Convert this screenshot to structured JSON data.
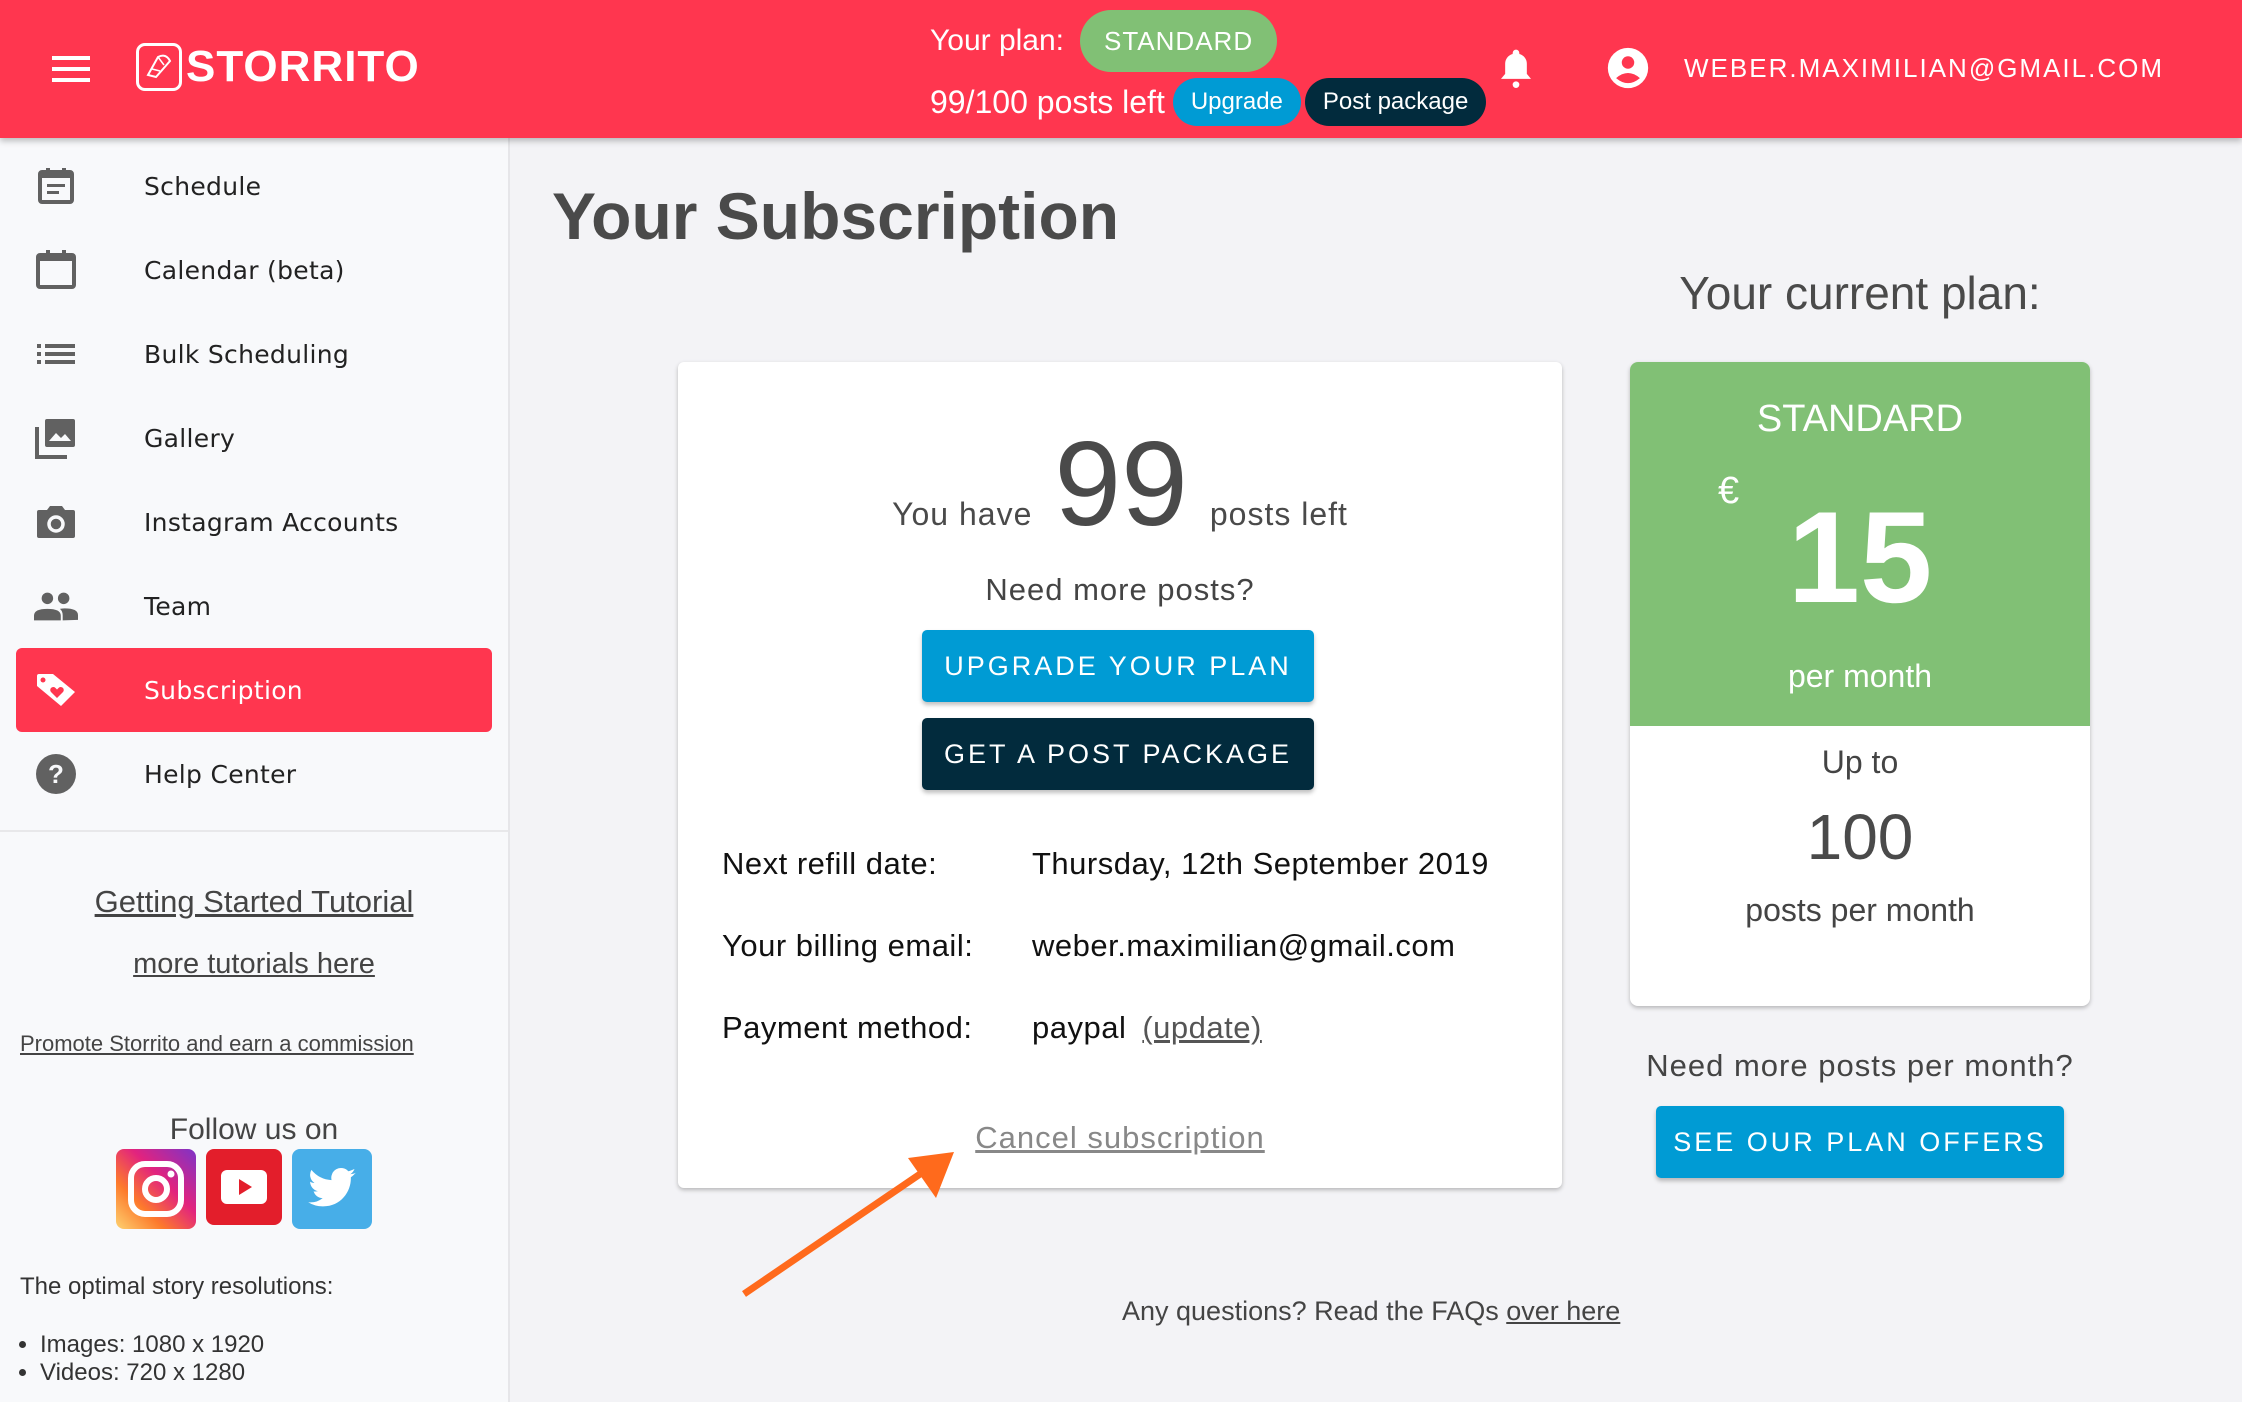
{
  "header": {
    "brand": "STORRITO",
    "plan_label": "Your plan:",
    "plan_badge": "STANDARD",
    "posts_left": "99/100 posts left",
    "upgrade_button": "Upgrade",
    "post_package_button": "Post package",
    "account_email": "WEBER.MAXIMILIAN@GMAIL.COM",
    "brand_color": "#ff364f"
  },
  "sidebar": {
    "items": [
      {
        "label": "Schedule",
        "icon": "schedule-icon"
      },
      {
        "label": "Calendar (beta)",
        "icon": "calendar-icon"
      },
      {
        "label": "Bulk Scheduling",
        "icon": "list-icon"
      },
      {
        "label": "Gallery",
        "icon": "gallery-icon"
      },
      {
        "label": "Instagram Accounts",
        "icon": "camera-icon"
      },
      {
        "label": "Team",
        "icon": "team-icon"
      },
      {
        "label": "Subscription",
        "icon": "tag-heart-icon",
        "active": true
      },
      {
        "label": "Help Center",
        "icon": "help-icon"
      }
    ],
    "getting_started": "Getting Started Tutorial",
    "more_tutorials": "more tutorials here",
    "promote": "Promote Storrito and earn a commission",
    "follow_us": "Follow us on",
    "resolutions_title": "The optimal story resolutions:",
    "resolutions": [
      "Images: 1080 x 1920",
      "Videos: 720 x 1280"
    ]
  },
  "main": {
    "title": "Your Subscription",
    "you_have": "You have",
    "posts_count": "99",
    "posts_left": "posts left",
    "need_more": "Need more posts?",
    "upgrade_plan_button": "UPGRADE YOUR PLAN",
    "post_package_button": "GET A POST PACKAGE",
    "details": [
      {
        "label": "Next refill date:",
        "value": "Thursday, 12th September 2019"
      },
      {
        "label": "Your billing email:",
        "value": "weber.maximilian@gmail.com"
      },
      {
        "label": "Payment method:",
        "value": "paypal"
      }
    ],
    "update_link": "(update)",
    "cancel_link": "Cancel subscription",
    "faq_text": "Any questions? Read the FAQs",
    "faq_link": "over here"
  },
  "current_plan": {
    "title": "Your current plan:",
    "name": "STANDARD",
    "currency": "€",
    "price": "15",
    "period": "per month",
    "up_to": "Up to",
    "posts": "100",
    "posts_period": "posts per month",
    "need_more": "Need more posts per month?",
    "offers_button": "SEE OUR PLAN OFFERS"
  }
}
